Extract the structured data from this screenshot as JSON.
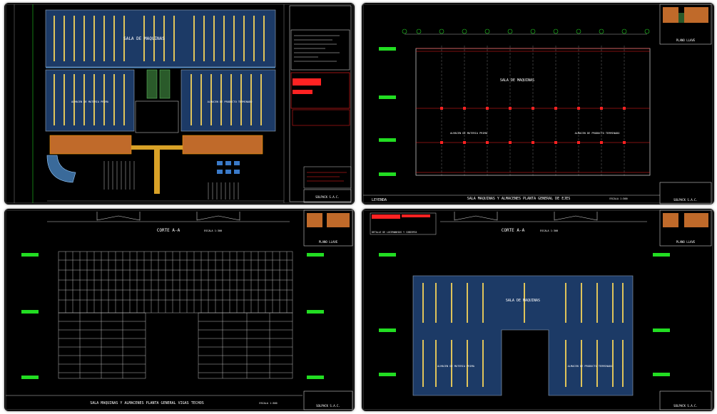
{
  "colors": {
    "background": "#000000",
    "roof_blue": "#1c3a66",
    "beam_yellow": "#e0c45a",
    "annotation_red": "#ff2222",
    "axis_green": "#22cc22",
    "structure_grey": "#bbbbbb",
    "slab_orange": "#c06a2a",
    "white": "#ffffff"
  },
  "panel1": {
    "sala_label": "SALA DE MAQUINAS",
    "almacen_mp": "ALMACEN DE MATERIA PRIMA",
    "almacen_pt": "ALMACEN DE PRODUCTO TERMINADO",
    "company": "SOLPACK S.A.C."
  },
  "panel2": {
    "sala_label": "SALA DE MAQUINAS",
    "almacen_mp": "ALMACEN DE MATERIA PRIMA",
    "almacen_pt": "ALMACEN DE PRODUCTO TERMINADO",
    "leyenda": "LEYENDA",
    "plano_llave": "PLANO LLAVE",
    "title": "SALA MAQUINAS Y ALMACENES PLANTA GENERAL DE EJES",
    "scale": "ESCALA 1:300",
    "company": "SOLPACK S.A.C."
  },
  "panel3": {
    "corte": "CORTE A-A",
    "corte_scale": "ESCALA 1:300",
    "plano_llave": "PLANO LLAVE",
    "title": "SALA MAQUINAS Y ALMACENES PLANTA GENERAL VIGAS TECHOS",
    "scale": "ESCALA 1:300",
    "company": "SOLPACK S.A.C."
  },
  "panel4": {
    "detalle": "DETALLE DE LUCERNARIOS Y CUBIERTA",
    "corte": "CORTE A-A",
    "corte_scale": "ESCALA 1:300",
    "plano_llave": "PLANO LLAVE",
    "sala_label": "SALA DE MAQUINAS",
    "almacen_mp": "ALMACEN DE MATERIA PRIMA",
    "almacen_pt": "ALMACEN DE PRODUCTO TERMINADO",
    "company": "SOLPACK S.A.C."
  }
}
